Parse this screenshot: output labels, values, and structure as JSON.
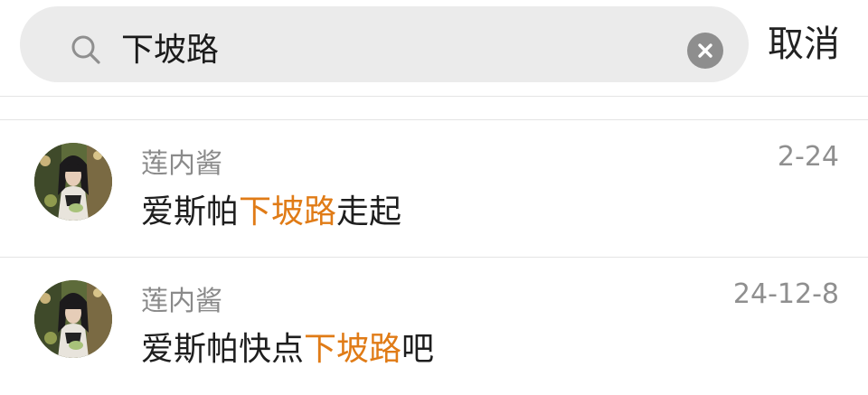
{
  "search": {
    "query": "下坡路",
    "clear_icon": "clear-icon",
    "search_icon": "search-icon"
  },
  "cancel_label": "取消",
  "highlight_color": "#e07b16",
  "results": [
    {
      "sender": "莲内酱",
      "time": "2-24",
      "message_before": "爱斯帕",
      "message_highlight": "下坡路",
      "message_after": "走起"
    },
    {
      "sender": "莲内酱",
      "time": "24-12-8",
      "message_before": "爱斯帕快点",
      "message_highlight": "下坡路",
      "message_after": "吧"
    }
  ]
}
